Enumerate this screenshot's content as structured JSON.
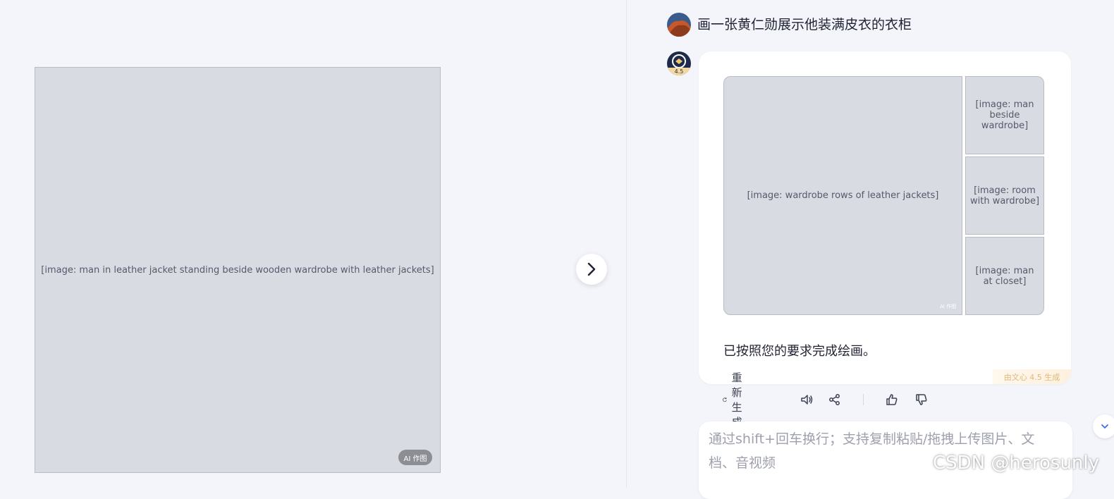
{
  "viewer": {
    "image_placeholder": "[image: man in leather jacket standing beside wooden wardrobe with leather jackets]",
    "ai_badge": "AI 作图"
  },
  "chat": {
    "user_message": "画一张黄仁勋展示他装满皮衣的衣柜",
    "bot_version": "4.5",
    "images": {
      "main": "[image: wardrobe rows of leather jackets]",
      "thumb1": "[image: man beside wardrobe]",
      "thumb2": "[image: room with wardrobe]",
      "thumb3": "[image: man at closet]",
      "small_badge": "AI 作图"
    },
    "response_text": "已按照您的要求完成绘画。",
    "generated_by": "由文心 4.5 生成",
    "actions": {
      "regenerate": "重新生成"
    },
    "input_placeholder": "通过shift+回车换行；支持复制粘贴/拖拽上传图片、文档、音视频"
  },
  "watermark": "CSDN @herosunly",
  "colors": {
    "background": "#f4f5fb",
    "bubble": "#ffffff",
    "accent_gold": "#e0b97a",
    "text_primary": "#1f2233",
    "placeholder_text": "#9da0ad"
  }
}
